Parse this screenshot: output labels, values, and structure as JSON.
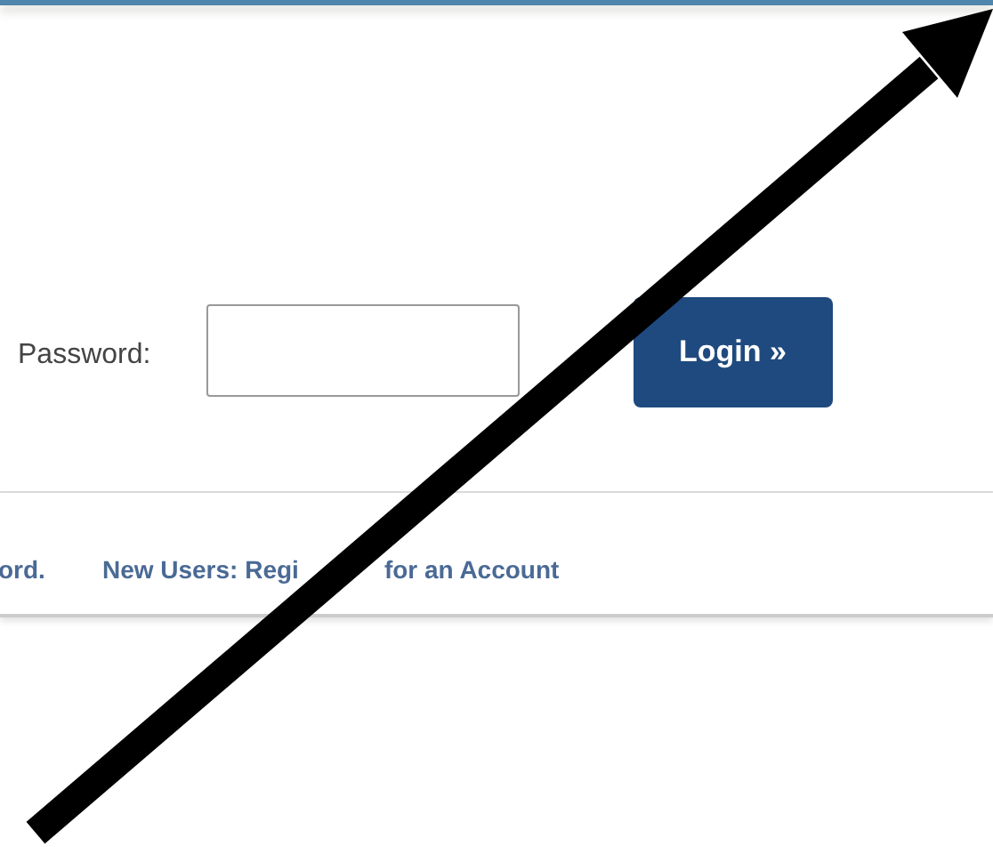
{
  "login": {
    "password_label": "Password:",
    "button": "Login »"
  },
  "links": [
    {
      "label": "ord."
    },
    {
      "label": "New Users: Regi"
    },
    {
      "label": "for an Account"
    }
  ]
}
